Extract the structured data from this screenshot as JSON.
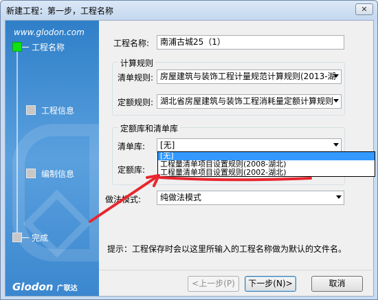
{
  "window": {
    "title": "新建工程：第一步，工程名称",
    "close_glyph": "✕"
  },
  "banner": {
    "url": "www.glodon.com",
    "steps": [
      {
        "label": "工程名称",
        "active": true
      },
      {
        "label": "工程信息",
        "active": false
      },
      {
        "label": "编制信息",
        "active": false
      },
      {
        "label": "完成",
        "active": false
      }
    ],
    "brand": "Glodon",
    "brand_cn": "广联达"
  },
  "form": {
    "project_name_label": "工程名称:",
    "project_name_value": "南浦古城25（1）",
    "calc_rules_group": "计算规则",
    "list_rule_label": "清单规则:",
    "list_rule_value": "房屋建筑与装饰工程计量规范计算规则(2013-湖",
    "quota_rule_label": "定额规则:",
    "quota_rule_value": "湖北省房屋建筑与装饰工程消耗量定额计算规则",
    "library_group": "定额库和清单库",
    "list_lib_label": "清单库:",
    "list_lib_value": "[无]",
    "quota_lib_label": "定额库:",
    "list_lib_options": [
      "[无]",
      "工程量清单项目设置规则(2008-湖北)",
      "工程量清单项目设置规则(2002-湖北)"
    ],
    "method_label": "做法模式:",
    "method_value": "纯做法模式",
    "hint": "提示：工程保存时会以这里所输入的工程名称做为默认的文件名。"
  },
  "buttons": {
    "prev": "<上一步(P)",
    "next": "下一步(N)>",
    "cancel": "取消"
  },
  "colors": {
    "accent": "#3399ff",
    "annotation": "#e8262e",
    "active_step": "#11e011"
  }
}
